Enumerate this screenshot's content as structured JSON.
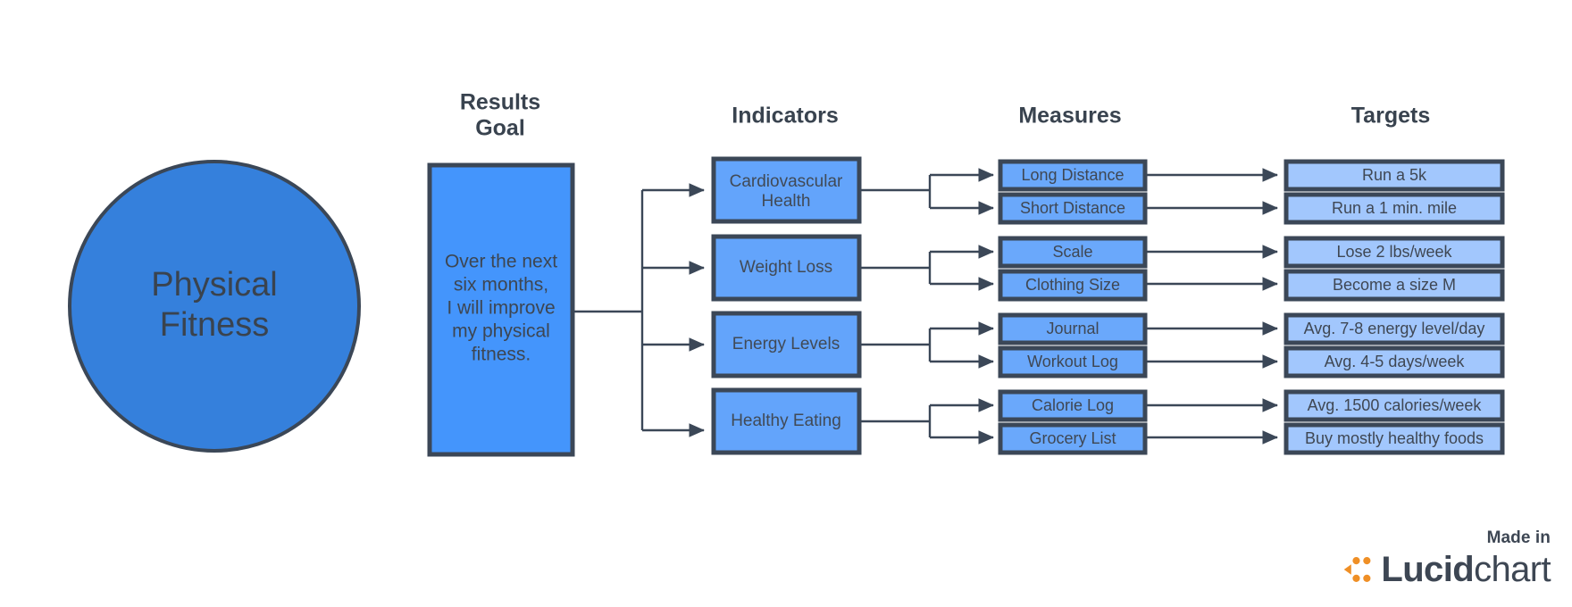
{
  "diagram": {
    "title_shape": {
      "label": "Physical Fitness",
      "lines": [
        "Physical",
        "Fitness"
      ],
      "shape": "circle",
      "fill": "#3580dc",
      "stroke": "#3b4757"
    },
    "columns": [
      {
        "id": "results-goal",
        "header": "Results Goal",
        "header_lines": [
          "Results",
          "Goal"
        ]
      },
      {
        "id": "indicators",
        "header": "Indicators",
        "header_lines": [
          "Indicators"
        ]
      },
      {
        "id": "measures",
        "header": "Measures",
        "header_lines": [
          "Measures"
        ]
      },
      {
        "id": "targets",
        "header": "Targets",
        "header_lines": [
          "Targets"
        ]
      }
    ],
    "results_goal": {
      "text": "Over the next six months, I will improve my physical fitness.",
      "lines": [
        "Over the next",
        "six months,",
        "I will improve",
        "my physical",
        "fitness."
      ],
      "fill": "#4495fc",
      "stroke": "#3b4757"
    },
    "indicators": [
      {
        "id": "cardiovascular-health",
        "label": "Cardiovascular Health",
        "lines": [
          "Cardiovascular",
          "Health"
        ]
      },
      {
        "id": "weight-loss",
        "label": "Weight Loss",
        "lines": [
          "Weight Loss"
        ]
      },
      {
        "id": "energy-levels",
        "label": "Energy Levels",
        "lines": [
          "Energy Levels"
        ]
      },
      {
        "id": "healthy-eating",
        "label": "Healthy Eating",
        "lines": [
          "Healthy Eating"
        ]
      }
    ],
    "measures": [
      {
        "id": "long-distance",
        "label": "Long Distance",
        "indicator": "cardiovascular-health"
      },
      {
        "id": "short-distance",
        "label": "Short Distance",
        "indicator": "cardiovascular-health"
      },
      {
        "id": "scale",
        "label": "Scale",
        "indicator": "weight-loss"
      },
      {
        "id": "clothing-size",
        "label": "Clothing Size",
        "indicator": "weight-loss"
      },
      {
        "id": "journal",
        "label": "Journal",
        "indicator": "energy-levels"
      },
      {
        "id": "workout-log",
        "label": "Workout Log",
        "indicator": "energy-levels"
      },
      {
        "id": "calorie-log",
        "label": "Calorie Log",
        "indicator": "healthy-eating"
      },
      {
        "id": "grocery-list",
        "label": "Grocery List",
        "indicator": "healthy-eating"
      }
    ],
    "targets": [
      {
        "id": "run-a-5k",
        "label": "Run a 5k",
        "measure": "long-distance"
      },
      {
        "id": "run-a-1-min-mile",
        "label": "Run a 1 min. mile",
        "measure": "short-distance"
      },
      {
        "id": "lose-2-lbs-week",
        "label": "Lose 2 lbs/week",
        "measure": "scale"
      },
      {
        "id": "become-a-size-m",
        "label": "Become a size M",
        "measure": "clothing-size"
      },
      {
        "id": "avg-7-8-energy-level-day",
        "label": "Avg. 7-8 energy level/day",
        "measure": "journal"
      },
      {
        "id": "avg-4-5-days-week",
        "label": "Avg. 4-5 days/week",
        "measure": "workout-log"
      },
      {
        "id": "avg-1500-calories-week",
        "label": "Avg. 1500 calories/week",
        "measure": "calorie-log"
      },
      {
        "id": "buy-mostly-healthy-foods",
        "label": "Buy mostly healthy foods",
        "measure": "grocery-list"
      }
    ],
    "colors": {
      "circle_fill": "#3580dc",
      "goal_fill": "#4495fc",
      "indicator_fill": "#63a4fb",
      "measure_fill": "#6aa8fb",
      "target_fill": "#a2c7fd",
      "stroke": "#3b4757",
      "header_text": "#39434f",
      "node_text": "#414a56",
      "background": "#ffffff",
      "logo_orange": "#ef8f26",
      "logo_dark": "#3d4653"
    }
  },
  "credit": {
    "made_in": "Made in",
    "brand_bold": "Lucid",
    "brand_light": "chart",
    "logo_icon": "lucidchart-logo-icon"
  }
}
